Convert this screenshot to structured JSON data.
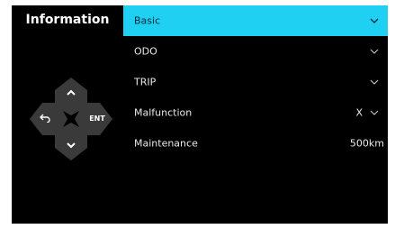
{
  "title": "Information",
  "dpad": {
    "up_icon": "chevron-up-icon",
    "down_icon": "chevron-down-icon",
    "back_icon": "back-arrow-icon",
    "ent_label": "ENT"
  },
  "menu": {
    "items": [
      {
        "label": "Basic",
        "value": "",
        "has_dropdown": true,
        "selected": true
      },
      {
        "label": "ODO",
        "value": "",
        "has_dropdown": true,
        "selected": false
      },
      {
        "label": "TRIP",
        "value": "",
        "has_dropdown": true,
        "selected": false
      },
      {
        "label": "Malfunction",
        "value": "X",
        "has_dropdown": true,
        "selected": false
      },
      {
        "label": "Maintenance",
        "value": "500km",
        "has_dropdown": false,
        "selected": false
      }
    ]
  },
  "colors": {
    "accent": "#1fd0f2",
    "screen_bg": "#000000",
    "dpad_bg": "#3a3a3a"
  }
}
